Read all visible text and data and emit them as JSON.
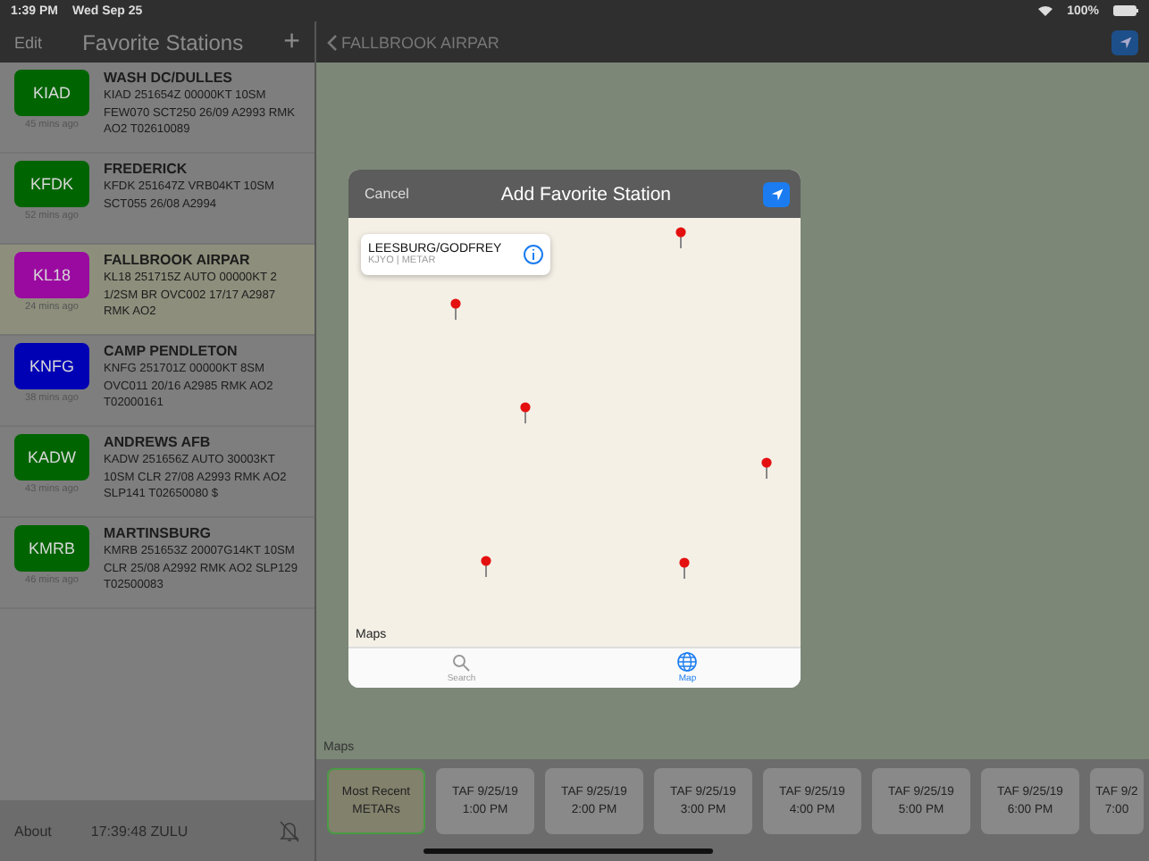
{
  "status_bar": {
    "time": "1:39 PM",
    "date": "Wed Sep 25",
    "battery": "100%"
  },
  "sidebar": {
    "edit": "Edit",
    "title": "Favorite Stations",
    "add": "+",
    "stations": [
      {
        "code": "KIAD",
        "color": "#006400",
        "age": "45 mins ago",
        "name": "WASH DC/DULLES",
        "report": "KIAD 251654Z 00000KT 10SM FEW070 SCT250 26/09 A2993 RMK AO2 T02610089",
        "selected": false
      },
      {
        "code": "KFDK",
        "color": "#006400",
        "age": "52 mins ago",
        "name": "FREDERICK",
        "report": "KFDK 251647Z VRB04KT 10SM SCT055 26/08 A2994",
        "selected": false
      },
      {
        "code": "KL18",
        "color": "#9a0aa0",
        "age": "24 mins ago",
        "name": "FALLBROOK AIRPAR",
        "report": "KL18 251715Z AUTO 00000KT 2 1/2SM BR OVC002 17/17 A2987 RMK AO2",
        "selected": true
      },
      {
        "code": "KNFG",
        "color": "#0000b4",
        "age": "38 mins ago",
        "name": "CAMP PENDLETON",
        "report": "KNFG 251701Z 00000KT 8SM OVC011 20/16 A2985 RMK AO2 T02000161",
        "selected": false
      },
      {
        "code": "KADW",
        "color": "#006400",
        "age": "43 mins ago",
        "name": "ANDREWS AFB",
        "report": "KADW 251656Z AUTO 30003KT 10SM CLR 27/08 A2993 RMK AO2 SLP141 T02650080 $",
        "selected": false
      },
      {
        "code": "KMRB",
        "color": "#006400",
        "age": "46 mins ago",
        "name": "MARTINSBURG",
        "report": "KMRB 251653Z 20007G14KT 10SM CLR 25/08 A2992 RMK AO2 SLP129 T02500083",
        "selected": false
      }
    ],
    "about": "About",
    "clock": "17:39:48 ZULU"
  },
  "main": {
    "back": "FALLBROOK AIRPAR",
    "maps_label": "Maps",
    "forecasts": [
      {
        "lines": [
          "Most Recent",
          "METARs"
        ],
        "selected": true
      },
      {
        "lines": [
          "TAF 9/25/19",
          "1:00 PM"
        ],
        "selected": false
      },
      {
        "lines": [
          "TAF 9/25/19",
          "2:00 PM"
        ],
        "selected": false
      },
      {
        "lines": [
          "TAF 9/25/19",
          "3:00 PM"
        ],
        "selected": false
      },
      {
        "lines": [
          "TAF 9/25/19",
          "4:00 PM"
        ],
        "selected": false
      },
      {
        "lines": [
          "TAF 9/25/19",
          "5:00 PM"
        ],
        "selected": false
      },
      {
        "lines": [
          "TAF 9/25/19",
          "6:00 PM"
        ],
        "selected": false
      },
      {
        "lines": [
          "TAF 9/2",
          "7:00"
        ],
        "selected": false
      }
    ]
  },
  "dialog": {
    "cancel": "Cancel",
    "title": "Add Favorite Station",
    "callout": {
      "name": "LEESBURG/GODFREY",
      "detail": "KJYO | METAR"
    },
    "maps_label": "Maps",
    "tabs": [
      {
        "label": "Search",
        "selected": false
      },
      {
        "label": "Map",
        "selected": true
      }
    ]
  }
}
